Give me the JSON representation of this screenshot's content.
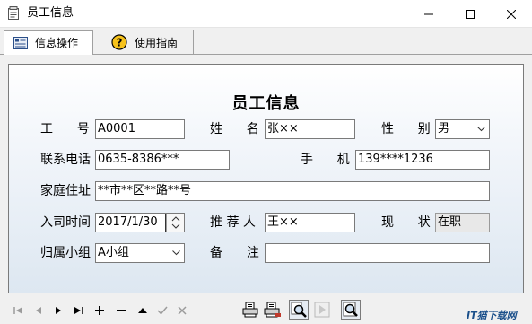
{
  "window": {
    "title": "员工信息"
  },
  "tabs": [
    {
      "label": "信息操作",
      "icon": "form-icon"
    },
    {
      "label": "使用指南",
      "icon": "help-icon"
    }
  ],
  "form": {
    "title": "员工信息",
    "employee_id": {
      "label": "工      号",
      "value": "A0001"
    },
    "name": {
      "label": "姓      名",
      "value": "张××"
    },
    "gender": {
      "label": "性      别",
      "value": "男"
    },
    "phone": {
      "label": "联系电话",
      "value": "0635-8386***"
    },
    "mobile": {
      "label": "手      机",
      "value": "139****1236"
    },
    "address": {
      "label": "家庭住址",
      "value": "**市**区**路**号"
    },
    "hire_date": {
      "label": "入司时间",
      "value": "2017/1/30"
    },
    "referrer": {
      "label": "推 荐 人",
      "value": "王××"
    },
    "status": {
      "label": "现      状",
      "value": "在职"
    },
    "group": {
      "label": "归属小组",
      "value": "A小组"
    },
    "remark": {
      "label": "备      注",
      "value": ""
    }
  },
  "watermark": "IT猫下载网"
}
